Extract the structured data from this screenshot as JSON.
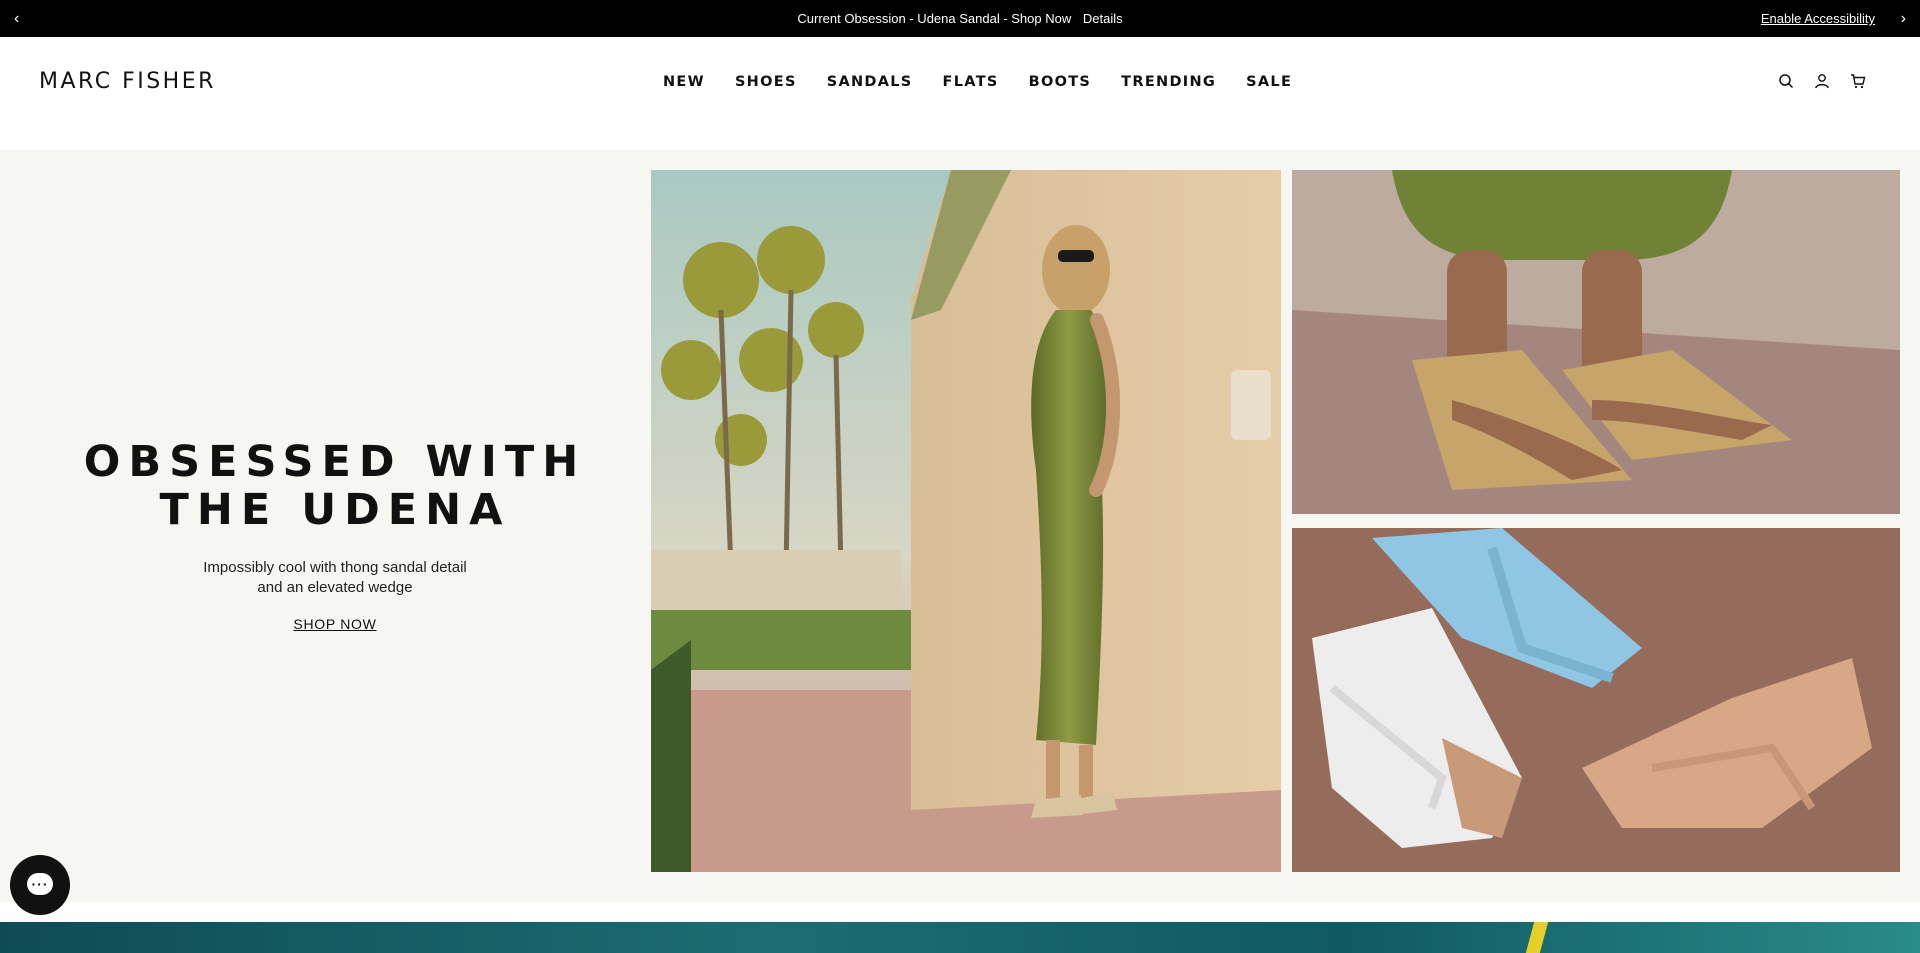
{
  "announcement": {
    "prev_icon": "chevron-left-icon",
    "next_icon": "chevron-right-icon",
    "text": "Current Obsession - Udena Sandal - Shop Now",
    "details_label": "Details",
    "accessibility_label": "Enable Accessibility"
  },
  "header": {
    "logo": "MARC FISHER",
    "nav": [
      "NEW",
      "SHOES",
      "SANDALS",
      "FLATS",
      "BOOTS",
      "TRENDING",
      "SALE"
    ],
    "icons": [
      "search-icon",
      "account-icon",
      "cart-icon"
    ]
  },
  "hero": {
    "title_line1": "OBSESSED WITH",
    "title_line2": "THE UDENA",
    "subtitle_line1": "Impossibly cool with thong sandal detail",
    "subtitle_line2": "and an elevated wedge",
    "cta": "SHOP NOW"
  },
  "colors": {
    "topbar_bg": "#000000",
    "hero_bg": "#f6f6f2",
    "text": "#111111"
  },
  "chat": {
    "icon": "chat-icon"
  }
}
